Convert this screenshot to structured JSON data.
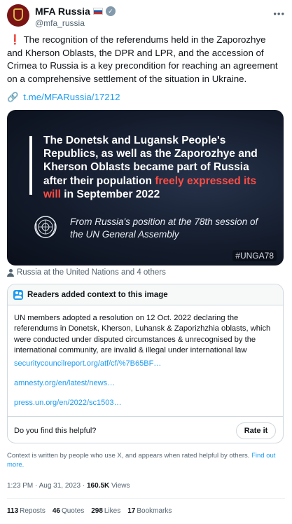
{
  "author": {
    "name": "MFA Russia",
    "flag_emoji": "🇷🇺",
    "handle": "@mfa_russia",
    "verified": true,
    "verified_color": "#829aab"
  },
  "tweet": {
    "emoji": "❗",
    "text": "The recognition of the referendums held in the Zaporozhye and Kherson Oblasts, the DPR and LPR, and the accession of Crimea to Russia is a key precondition for reaching an agreement on a comprehensive settlement of the situation in Ukraine.",
    "link_icon": "🔗",
    "link_text": "t.me/MFARussia/17212"
  },
  "media": {
    "headline_white": "The Donetsk and Lugansk People's Republics, as well as the Zaporozhye and Kherson Oblasts became part of Russia after their population ",
    "headline_red": "freely expressed its will",
    "headline_end": " in September 2022",
    "quote": "From Russia's position at the 78th session of the UN General Assembly",
    "hashtag": "#UNGA78",
    "highlight_color": "#ff4d44"
  },
  "tagged": "Russia at the United Nations and 4 others",
  "note": {
    "title": "Readers added context to this image",
    "body": "UN members adopted a resolution on 12 Oct. 2022 declaring the referendums in Donetsk, Kherson, Luhansk & Zaporizhzhia oblasts, which were conducted under disputed circumstances & unrecognised by the international community, are invalid & illegal under international law",
    "sources": [
      "securitycouncilreport.org/atf/cf/%7B65BF…",
      "amnesty.org/en/latest/news…",
      "press.un.org/en/2022/sc1503…"
    ],
    "helpful_question": "Do you find this helpful?",
    "rate_label": "Rate it"
  },
  "context_note": {
    "text": "Context is written by people who use X, and appears when rated helpful by others.",
    "link": "Find out more."
  },
  "meta": {
    "time": "1:23 PM",
    "separator": " · ",
    "date": "Aug 31, 2023",
    "views_count": "160.5K",
    "views_label": "Views"
  },
  "stats": {
    "reposts_count": "113",
    "reposts_label": "Reposts",
    "quotes_count": "46",
    "quotes_label": "Quotes",
    "likes_count": "298",
    "likes_label": "Likes",
    "bookmarks_count": "17",
    "bookmarks_label": "Bookmarks"
  },
  "colors": {
    "link": "#1d9bf0",
    "secondary_text": "#536471",
    "border": "#cfd9de"
  }
}
